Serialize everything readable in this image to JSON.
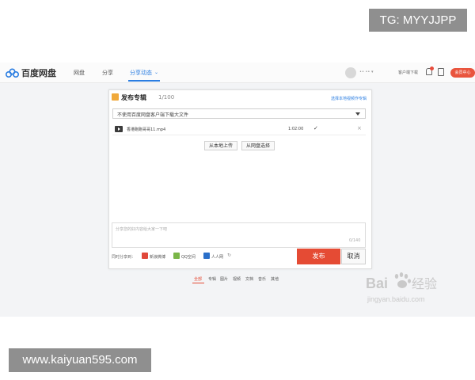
{
  "watermarks": {
    "top": "TG: MYYJJPP",
    "bottom": "www.kaiyuan595.com"
  },
  "header": {
    "brand": "百度网盘",
    "nav": [
      "网盘",
      "分享",
      "分享动态"
    ],
    "active_nav": "分享动态",
    "user_name": "•• •• ▾",
    "client_download": "客户端下载",
    "vip_badge": "会员中心",
    "accent": "#2a7de1"
  },
  "dialog": {
    "title": "发布专辑",
    "count": "1/100",
    "link_text": "选择本地视频作专辑",
    "select_value": "不使用百度网盘客户端下载大文件",
    "file": {
      "name": "香港跑跑哥哥11.mp4",
      "duration": "1:02:00"
    },
    "upload_local": "从本地上传",
    "select_from_disk": "从网盘选择",
    "desc_placeholder": "分享您的好内容给大家一下吧",
    "desc_count": "0/140",
    "share_to_label": "同时分享到：",
    "share_targets": [
      "新浪微博",
      "QQ空间",
      "人人网"
    ],
    "publish_label": "发布",
    "cancel_label": "取消",
    "publish_color": "#e54b34"
  },
  "bottom_tabs": [
    "全部",
    "专辑",
    "图片",
    "视频",
    "文档",
    "音乐",
    "其他"
  ],
  "active_tab": "全部",
  "baidu_watermark": {
    "logo": "Baidu",
    "label": "经验",
    "url": "jingyan.baidu.com"
  }
}
